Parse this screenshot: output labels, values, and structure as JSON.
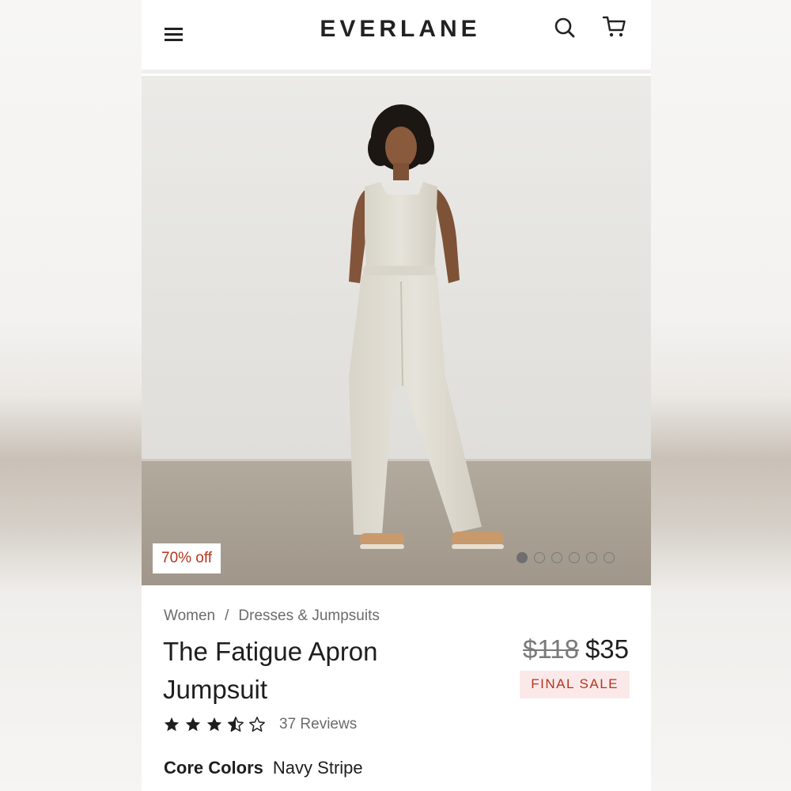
{
  "header": {
    "logo": "EVERLANE",
    "icons": [
      "menu-icon",
      "search-icon",
      "cart-icon"
    ]
  },
  "hero": {
    "badge": "70% off",
    "carousel_total": 6,
    "carousel_active": 1
  },
  "breadcrumb": {
    "items": [
      "Women",
      "Dresses & Jumpsuits"
    ],
    "separator": "/"
  },
  "product": {
    "title": "The Fatigue Apron Jumpsuit",
    "old_price": "$118",
    "price": "$35",
    "sale_label": "FINAL SALE",
    "rating": 3.5,
    "rating_max": 5,
    "reviews": "37 Reviews",
    "colors_label": "Core Colors",
    "color_value": "Navy Stripe"
  },
  "colors": {
    "sale_text": "#b8341f",
    "sale_bg": "#fbe9e9",
    "text": "#1e1e1e",
    "muted": "#6b6b6b"
  }
}
